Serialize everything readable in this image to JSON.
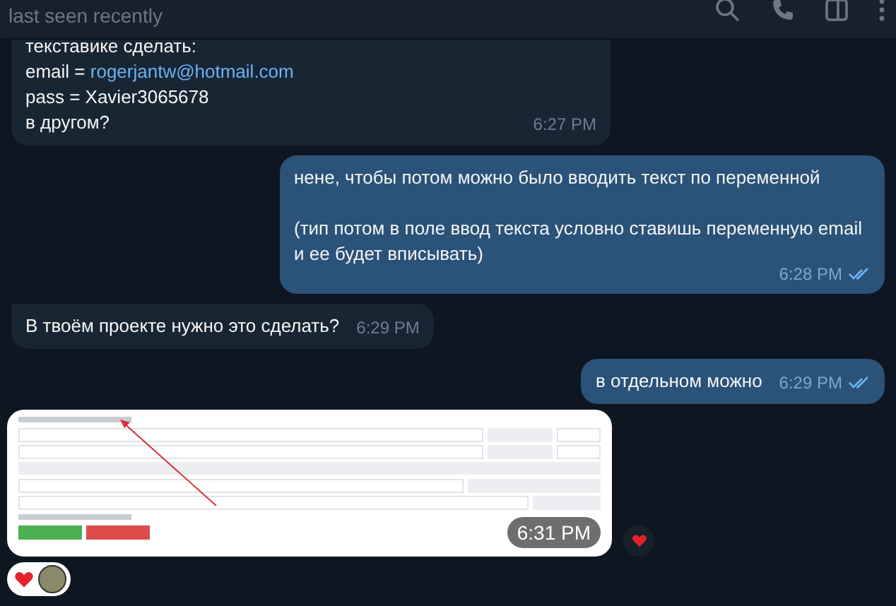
{
  "header": {
    "status": "last seen recently"
  },
  "messages": [
    {
      "kind": "text",
      "outgoing": false,
      "paragraphs": [
        [
          {
            "text": "текставике сделать:"
          },
          {
            "text": "email = ",
            "link": "rogerjantw@hotmail.com"
          },
          {
            "text": "pass = Xavier3065678"
          },
          {
            "text": "в другом?"
          }
        ]
      ],
      "time": "6:27 PM"
    },
    {
      "kind": "text",
      "outgoing": true,
      "read": true,
      "paragraphs": [
        [
          {
            "text": "нене, чтобы потом можно было вводить текст по переменной"
          }
        ],
        [
          {
            "text": "(тип потом в поле ввод текста условно ставишь переменную email и ее будет вписывать)"
          }
        ]
      ],
      "time": "6:28 PM"
    },
    {
      "kind": "text",
      "outgoing": false,
      "paragraphs": [
        [
          {
            "text": "В твоём проекте нужно это сделать?"
          }
        ]
      ],
      "time": "6:29 PM"
    },
    {
      "kind": "text",
      "outgoing": true,
      "read": true,
      "paragraphs": [
        [
          {
            "text": "в отдельном можно"
          }
        ]
      ],
      "time": "6:29 PM"
    },
    {
      "kind": "image",
      "outgoing": false,
      "time": "6:31 PM",
      "quick_reaction": true,
      "reactions": [
        {
          "kind": "heart"
        },
        {
          "kind": "avatar"
        }
      ]
    }
  ]
}
